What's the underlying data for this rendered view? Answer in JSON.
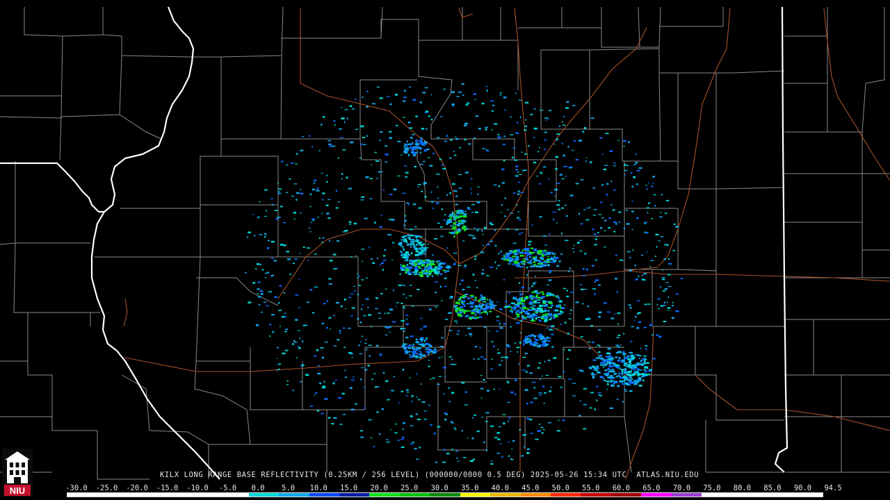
{
  "caption": "KILX LONG RANGE BASE REFLECTIVITY (0.25KM / 256 LEVEL) (000000/0000 0.5 DEG) 2025-05-26 15:34 UTC  ATLAS.NIU.EDU",
  "logo": {
    "text": "NIU",
    "icon": "niu-altgeld-tower-logo",
    "colors": {
      "background": "#0b0b0b",
      "accent": "#c8102e",
      "tower": "#ffffff"
    }
  },
  "color_scale": {
    "labels": [
      "-30.0",
      "-25.0",
      "-20.0",
      "-15.0",
      "-10.0",
      "-5.0",
      "0.0",
      "5.0",
      "10.0",
      "15.0",
      "20.0",
      "25.0",
      "30.0",
      "35.0",
      "40.0",
      "45.0",
      "50.0",
      "55.0",
      "60.0",
      "65.0",
      "70.0",
      "75.0",
      "80.0",
      "85.0",
      "90.0",
      "94.5"
    ],
    "colors": [
      "#ffffff",
      "#ffffff",
      "#ffffff",
      "#ffffff",
      "#ffffff",
      "#ffffff",
      "#00d8d8",
      "#11a8e8",
      "#0a4cff",
      "#0a20a8",
      "#13e21a",
      "#0ac00a",
      "#068c06",
      "#f6f600",
      "#e8b800",
      "#ff8a00",
      "#ff2a00",
      "#c80000",
      "#a00000",
      "#ff00ff",
      "#9a40d0",
      "#ffffff",
      "#ffffff",
      "#ffffff",
      "#ffffff"
    ]
  },
  "map": {
    "colors": {
      "background": "#000000",
      "county_line": "#8c8c8c",
      "state_line": "#ffffff",
      "highway": "#a5532a"
    }
  }
}
